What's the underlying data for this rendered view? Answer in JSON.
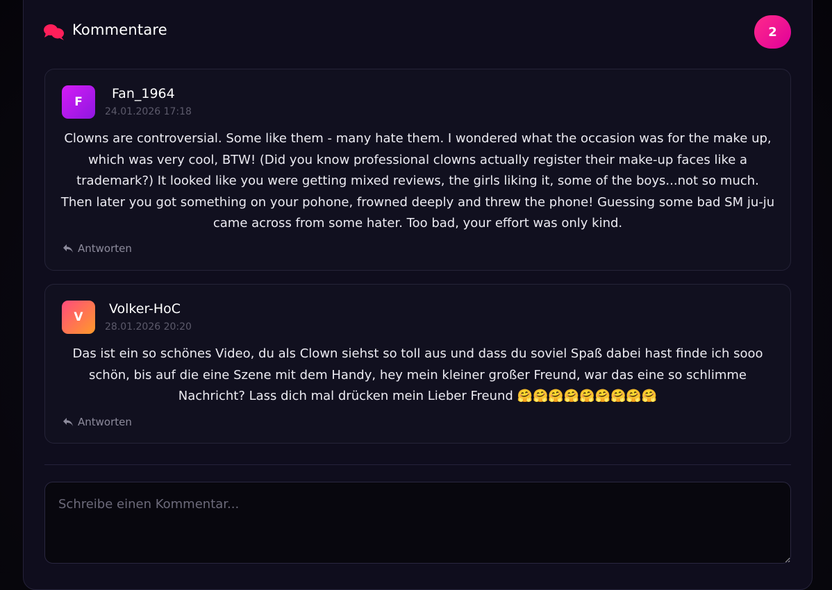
{
  "header": {
    "icon": "comments-icon",
    "title": "Kommentare",
    "count": "2",
    "accent": "#ff1f8f"
  },
  "comments": [
    {
      "avatar_letter": "F",
      "author": "Fan_1964",
      "date": "24.01.2026 17:18",
      "text": "Clowns are controversial. Some like them - many hate them. I wondered what the occasion was for the make up, which was very cool, BTW! (Did you know professional clowns actually register their make-up faces like a trademark?) It looked like you were getting mixed reviews, the girls liking it, some of the boys...not so much. Then later you got something on your pohone, frowned deeply and threw the phone! Guessing some bad SM ju-ju came across from some hater. Too bad, your effort was only kind.",
      "reply_label": "Antworten"
    },
    {
      "avatar_letter": "V",
      "author": "Volker-HoC",
      "date": "28.01.2026 20:20",
      "text": "Das ist ein so schönes Video, du als Clown siehst so toll aus und dass du soviel Spaß dabei hast finde ich sooo schön, bis auf die eine Szene mit dem Handy, hey mein kleiner großer Freund, war das eine so schlimme Nachricht? Lass dich mal drücken mein Lieber Freund 🤗🤗🤗🤗🤗🤗🤗🤗🤗",
      "reply_label": "Antworten"
    }
  ],
  "new_comment": {
    "placeholder": "Schreibe einen Kommentar...",
    "value": ""
  }
}
